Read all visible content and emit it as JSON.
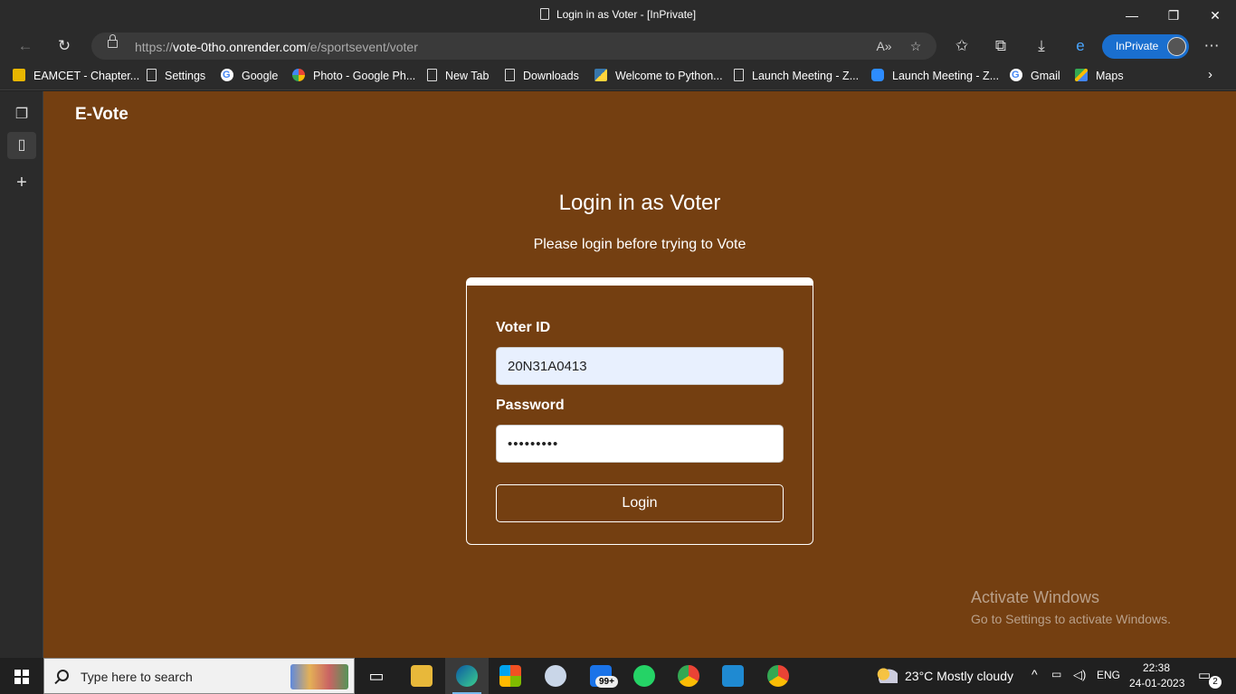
{
  "window": {
    "title": "Login in as Voter - [InPrivate]",
    "minimize_glyph": "—",
    "restore_glyph": "❐",
    "close_glyph": "✕"
  },
  "browser": {
    "url_prefix": "https://",
    "url_host": "vote-0tho.onrender.com",
    "url_path": "/e/sportsevent/voter",
    "inprivate_label": "InPrivate",
    "colors": {
      "inprivate": "#1a6fcf",
      "chrome": "#2b2b2b"
    }
  },
  "bookmarks": [
    {
      "label": "EAMCET - Chapter...",
      "icon": "eamcet-icon"
    },
    {
      "label": "Settings",
      "icon": "page-icon"
    },
    {
      "label": "Google",
      "icon": "google-icon"
    },
    {
      "label": "Photo - Google Ph...",
      "icon": "google-photos-icon"
    },
    {
      "label": "New Tab",
      "icon": "page-icon"
    },
    {
      "label": "Downloads",
      "icon": "page-icon"
    },
    {
      "label": "Welcome to Python...",
      "icon": "python-icon"
    },
    {
      "label": "Launch Meeting - Z...",
      "icon": "page-icon"
    },
    {
      "label": "Launch Meeting - Z...",
      "icon": "zoom-icon"
    },
    {
      "label": "Gmail",
      "icon": "google-icon"
    },
    {
      "label": "Maps",
      "icon": "maps-icon"
    }
  ],
  "page": {
    "brand": "E-Vote",
    "heading": "Login in as Voter",
    "subheading": "Please login before trying to Vote",
    "background_color": "#743f11",
    "form": {
      "voter_id_label": "Voter ID",
      "voter_id_value": "20N31A0413",
      "password_label": "Password",
      "password_masked": "•••••••••",
      "login_label": "Login"
    }
  },
  "watermark": {
    "line1": "Activate Windows",
    "line2": "Go to Settings to activate Windows."
  },
  "taskbar": {
    "search_placeholder": "Type here to search",
    "mail_badge": "99+",
    "weather": "23°C  Mostly cloudy",
    "language": "ENG",
    "time": "22:38",
    "date": "24-01-2023",
    "notification_count": "2"
  }
}
